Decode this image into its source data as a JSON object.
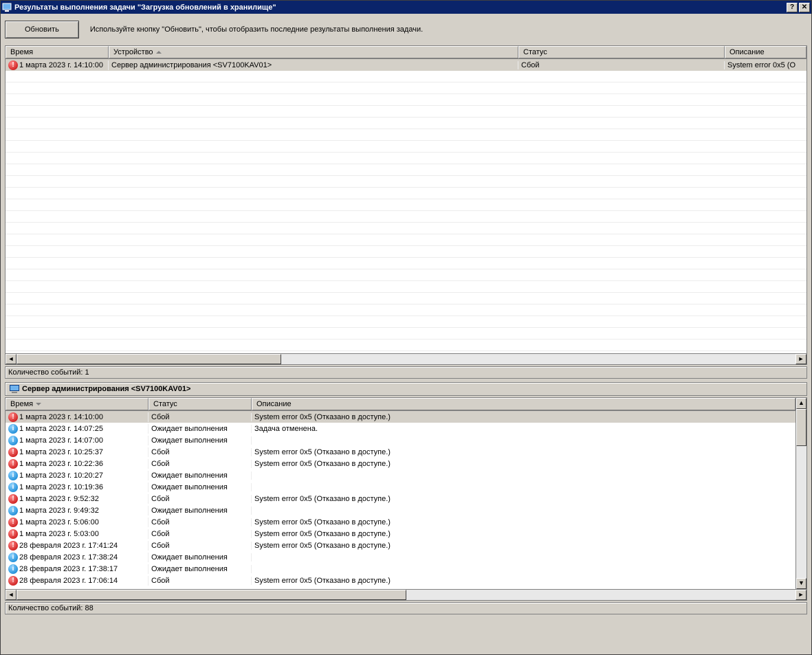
{
  "titlebar": {
    "title": "Результаты выполнения задачи \"Загрузка обновлений в хранилище\"",
    "help_glyph": "?",
    "close_glyph": "✕"
  },
  "toolbar": {
    "refresh_label": "Обновить",
    "hint": "Используйте кнопку \"Обновить\", чтобы отобразить последние результаты выполнения задачи."
  },
  "top_grid": {
    "columns": {
      "time": "Время",
      "device": "Устройство",
      "status": "Статус",
      "description": "Описание"
    },
    "sort_column": "device",
    "sort_dir": "asc",
    "rows": [
      {
        "icon": "error",
        "time": "1 марта 2023 г. 14:10:00",
        "device": "Сервер администрирования <SV7100KAV01>",
        "status": "Сбой",
        "description": "System error 0x5 (О"
      }
    ],
    "status": "Количество событий: 1"
  },
  "detail_header": "Сервер администрирования <SV7100KAV01>",
  "bottom_grid": {
    "columns": {
      "time": "Время",
      "status": "Статус",
      "description": "Описание"
    },
    "sort_column": "time",
    "sort_dir": "desc",
    "rows": [
      {
        "icon": "error",
        "time": "1 марта 2023 г. 14:10:00",
        "status": "Сбой",
        "description": "System error 0x5 (Отказано в доступе.)"
      },
      {
        "icon": "info",
        "time": "1 марта 2023 г. 14:07:25",
        "status": "Ожидает выполнения",
        "description": "Задача отменена."
      },
      {
        "icon": "info",
        "time": "1 марта 2023 г. 14:07:00",
        "status": "Ожидает выполнения",
        "description": ""
      },
      {
        "icon": "error",
        "time": "1 марта 2023 г. 10:25:37",
        "status": "Сбой",
        "description": "System error 0x5 (Отказано в доступе.)"
      },
      {
        "icon": "error",
        "time": "1 марта 2023 г. 10:22:36",
        "status": "Сбой",
        "description": "System error 0x5 (Отказано в доступе.)"
      },
      {
        "icon": "info",
        "time": "1 марта 2023 г. 10:20:27",
        "status": "Ожидает выполнения",
        "description": ""
      },
      {
        "icon": "info",
        "time": "1 марта 2023 г. 10:19:36",
        "status": "Ожидает выполнения",
        "description": ""
      },
      {
        "icon": "error",
        "time": "1 марта 2023 г. 9:52:32",
        "status": "Сбой",
        "description": "System error 0x5 (Отказано в доступе.)"
      },
      {
        "icon": "info",
        "time": "1 марта 2023 г. 9:49:32",
        "status": "Ожидает выполнения",
        "description": ""
      },
      {
        "icon": "error",
        "time": "1 марта 2023 г. 5:06:00",
        "status": "Сбой",
        "description": "System error 0x5 (Отказано в доступе.)"
      },
      {
        "icon": "error",
        "time": "1 марта 2023 г. 5:03:00",
        "status": "Сбой",
        "description": "System error 0x5 (Отказано в доступе.)"
      },
      {
        "icon": "error",
        "time": "28 февраля 2023 г. 17:41:24",
        "status": "Сбой",
        "description": "System error 0x5 (Отказано в доступе.)"
      },
      {
        "icon": "info",
        "time": "28 февраля 2023 г. 17:38:24",
        "status": "Ожидает выполнения",
        "description": ""
      },
      {
        "icon": "info",
        "time": "28 февраля 2023 г. 17:38:17",
        "status": "Ожидает выполнения",
        "description": ""
      },
      {
        "icon": "error",
        "time": "28 февраля 2023 г. 17:06:14",
        "status": "Сбой",
        "description": "System error 0x5 (Отказано в доступе.)"
      }
    ],
    "status": "Количество событий: 88"
  }
}
